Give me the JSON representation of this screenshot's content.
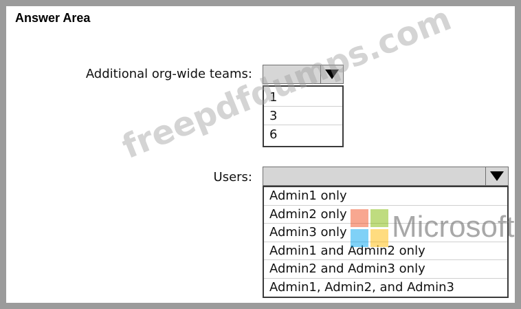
{
  "title": "Answer Area",
  "teams": {
    "label": "Additional org-wide teams:",
    "selected": "",
    "options": [
      "1",
      "3",
      "6"
    ]
  },
  "users": {
    "label": "Users:",
    "selected": "",
    "options": [
      "Admin1 only",
      "Admin2 only",
      "Admin3 only",
      "Admin1 and Admin2 only",
      "Admin2 and Admin3 only",
      "Admin1, Admin2, and Admin3"
    ]
  },
  "watermark": {
    "site_text": "freepdfdumps.com",
    "brand_text": "Microsoft",
    "logo_colors": [
      "#f25022",
      "#7fba00",
      "#00a4ef",
      "#ffb900"
    ]
  },
  "colors": {
    "frame": "#9b9b9b",
    "dropdown_header": "#d6d6d6"
  }
}
